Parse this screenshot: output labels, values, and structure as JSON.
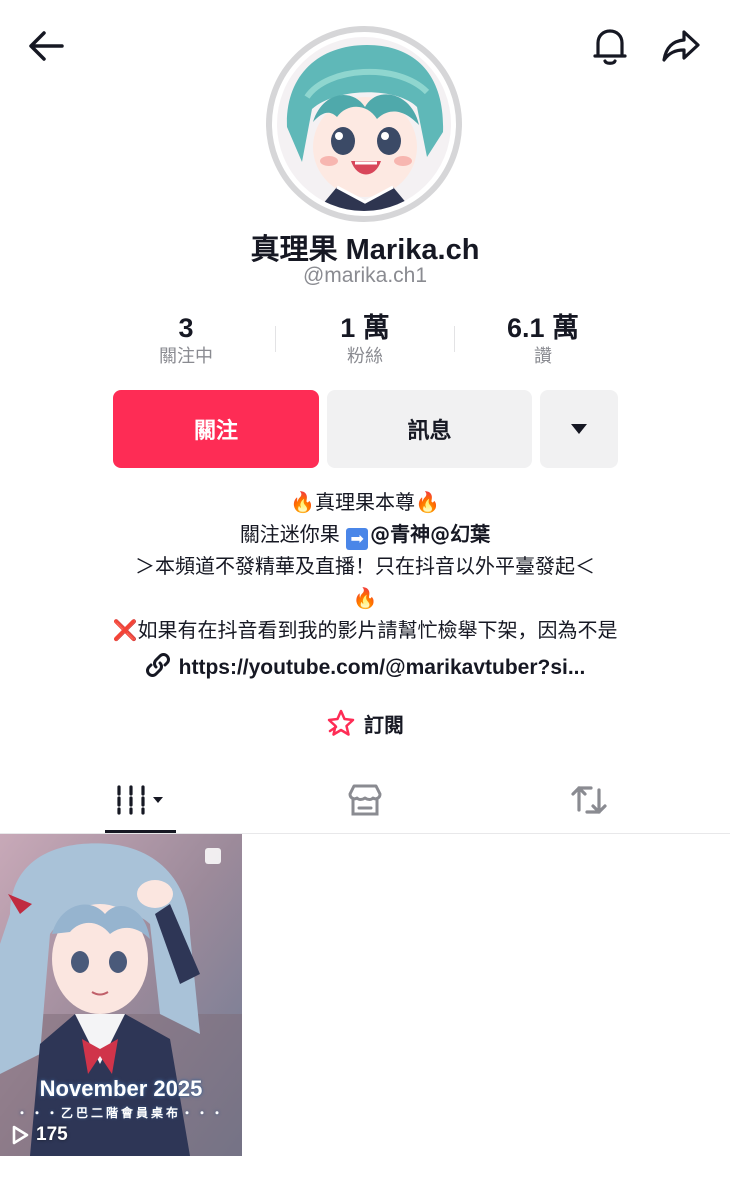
{
  "profile": {
    "display_name": "真理果 Marika.ch",
    "username": "@marika.ch1"
  },
  "stats": [
    {
      "value": "3",
      "label": "關注中"
    },
    {
      "value": "1 萬",
      "label": "粉絲"
    },
    {
      "value": "6.1 萬",
      "label": "讚"
    }
  ],
  "actions": {
    "follow_label": "關注",
    "message_label": "訊息"
  },
  "bio": {
    "line1": "🔥真理果本尊🔥",
    "line2_prefix": "關注迷你果",
    "line2_arrow": "➡",
    "line2_mentions": "@青神@幻葉",
    "line3": "＞本頻道不發精華及直播！只在抖音以外平臺發起＜",
    "line4": "🔥",
    "line5_mark": "❌",
    "line5": "如果有在抖音看到我的影片請幫忙檢舉下架，因為不是",
    "link": "https://youtube.com/@marikavtuber?si..."
  },
  "subscribe_label": "訂閱",
  "videos": [
    {
      "title_overlay": "November 2025",
      "subtitle_overlay": "・・・乙巴二階會員桌布・・・",
      "views": "175"
    }
  ],
  "colors": {
    "accent": "#fe2c55",
    "text": "#161823",
    "muted": "#8a8b91",
    "button_bg": "#f1f1f2"
  }
}
